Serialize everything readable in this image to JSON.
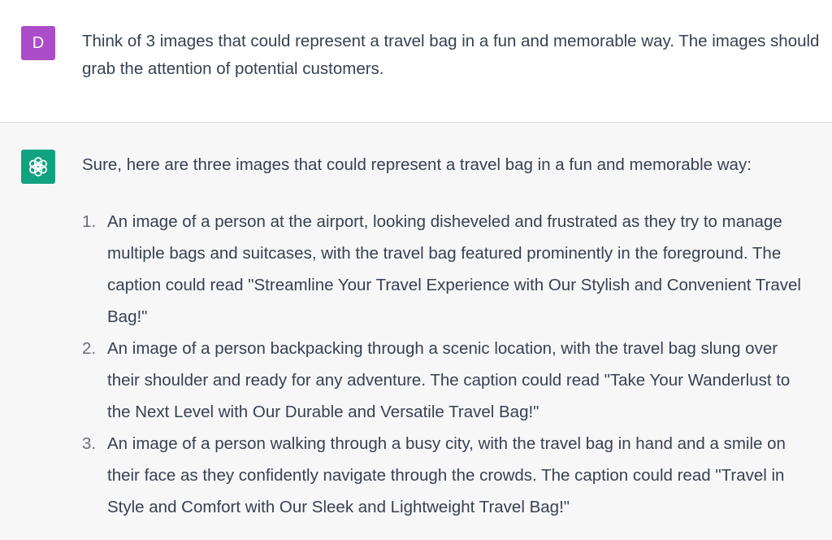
{
  "user_message": {
    "avatar_letter": "D",
    "text": "Think of 3 images that could represent a travel bag in a fun and memorable way. The images should grab the attention of potential customers."
  },
  "assistant_message": {
    "intro": "Sure, here are three images that could represent a travel bag in a fun and memorable way:",
    "items": [
      {
        "number": "1.",
        "text": "An image of a person at the airport, looking disheveled and frustrated as they try to manage multiple bags and suitcases, with the travel bag featured prominently in the foreground. The caption could read \"Streamline Your Travel Experience with Our Stylish and Convenient Travel Bag!\""
      },
      {
        "number": "2.",
        "text": "An image of a person backpacking through a scenic location, with the travel bag slung over their shoulder and ready for any adventure. The caption could read \"Take Your Wanderlust to the Next Level with Our Durable and Versatile Travel Bag!\""
      },
      {
        "number": "3.",
        "text": "An image of a person walking through a busy city, with the travel bag in hand and a smile on their face as they confidently navigate through the crowds. The caption could read \"Travel in Style and Comfort with Our Sleek and Lightweight Travel Bag!\""
      }
    ]
  },
  "colors": {
    "user_avatar": "#ab4cc9",
    "assistant_avatar": "#10a37f",
    "assistant_background": "#f7f7f8",
    "text": "#374151"
  },
  "icons": {
    "user_avatar": "user-avatar-icon",
    "assistant_avatar": "openai-logo-icon"
  }
}
